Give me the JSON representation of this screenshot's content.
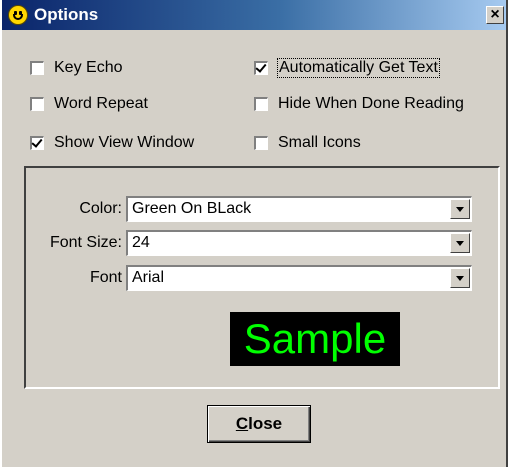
{
  "window": {
    "title": "Options",
    "close_glyph": "✕"
  },
  "checkboxes": [
    {
      "label": "Key Echo",
      "checked": false
    },
    {
      "label": "Automatically Get Text",
      "checked": true
    },
    {
      "label": "Word Repeat",
      "checked": false
    },
    {
      "label": "Hide When Done Reading",
      "checked": false
    },
    {
      "label": "Show View Window",
      "checked": true
    },
    {
      "label": "Small Icons",
      "checked": false
    }
  ],
  "settings": {
    "color_label": "Color:",
    "color_value": "Green On BLack",
    "font_size_label": "Font Size:",
    "font_size_value": "24",
    "font_label": "Font",
    "font_value": "Arial"
  },
  "sample": {
    "text": "Sample",
    "background": "#000000",
    "foreground": "#00ff00"
  },
  "close_button": {
    "accel": "C",
    "rest": "lose"
  }
}
